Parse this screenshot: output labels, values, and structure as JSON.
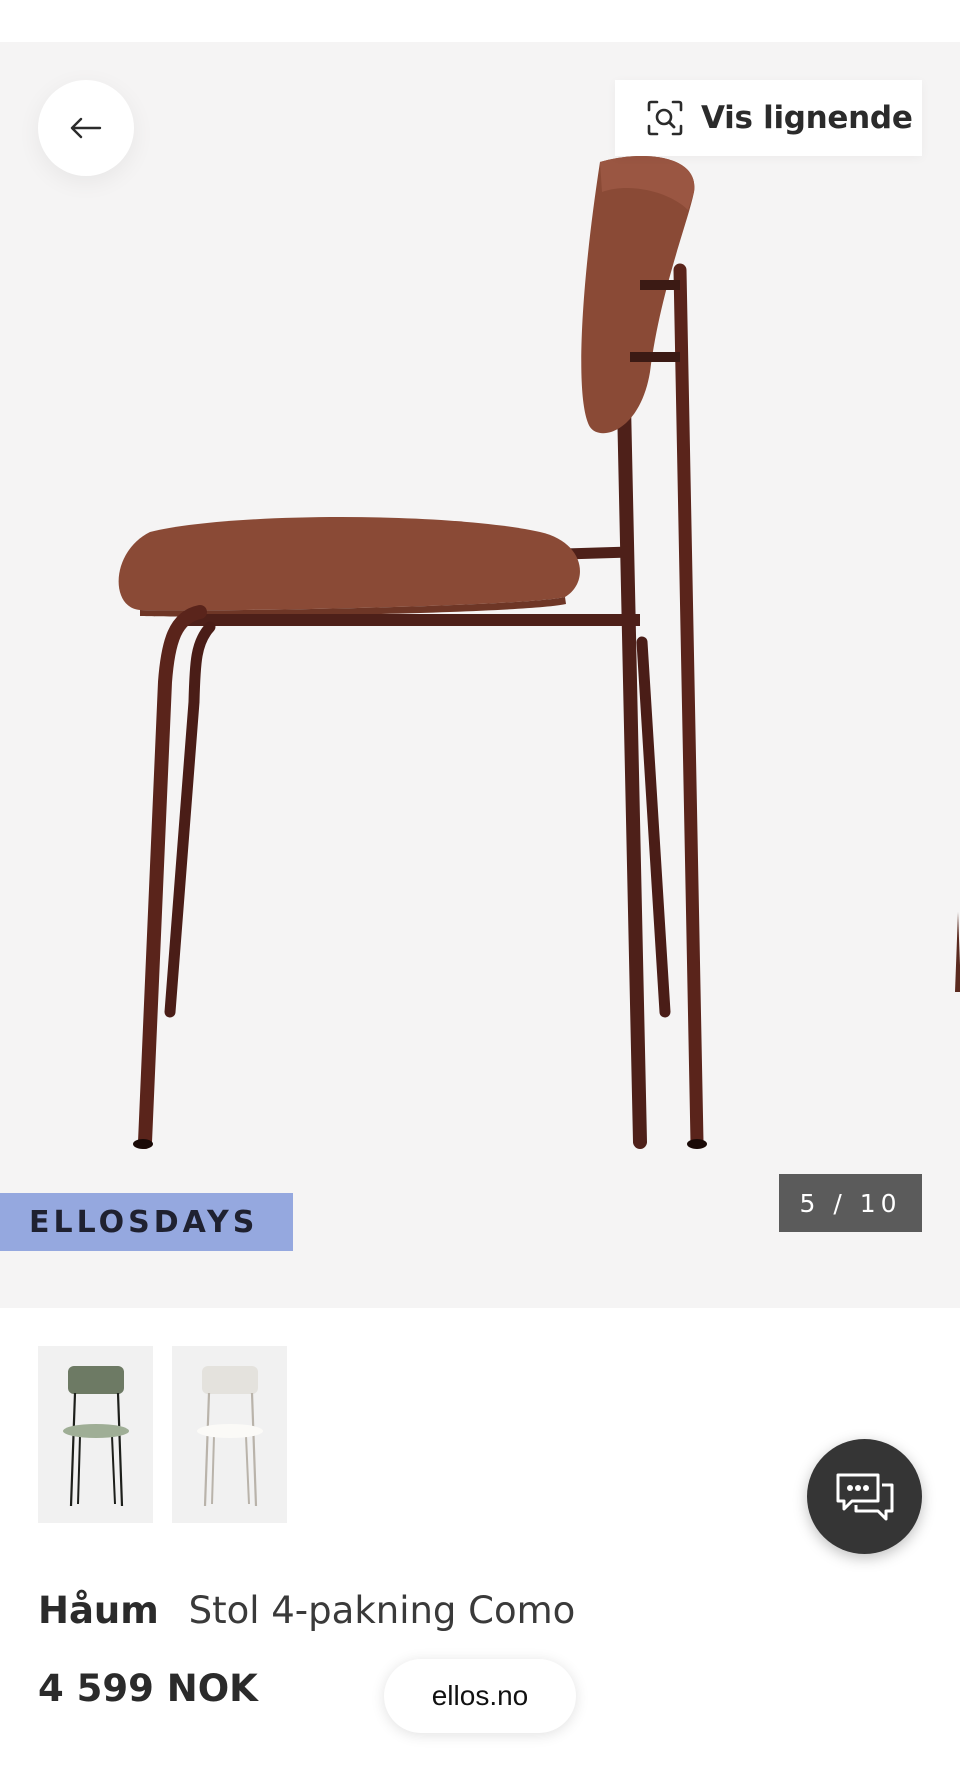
{
  "header": {
    "back_icon": "arrow-left-icon",
    "similar_icon": "visual-search-icon",
    "similar_label": "Vis lignende"
  },
  "gallery": {
    "promo_badge": "ELLOSDAYS",
    "counter": "5 / 10",
    "current_image": 5,
    "total_images": 10,
    "product_color": "#8a4a36",
    "background_color": "#f5f4f4"
  },
  "variants": [
    {
      "name": "green",
      "color": "#6d7a64"
    },
    {
      "name": "white",
      "color": "#e4e2dd"
    }
  ],
  "chat": {
    "icon": "chat-bubbles-icon"
  },
  "product": {
    "brand": "Håum",
    "name": "Stol 4-pakning Como",
    "price": "4 599 NOK"
  },
  "footer": {
    "site": "ellos.no"
  },
  "colors": {
    "promo_badge_bg": "#95a8df",
    "counter_bg": "#5b5b5b",
    "chat_bg": "#353535"
  }
}
